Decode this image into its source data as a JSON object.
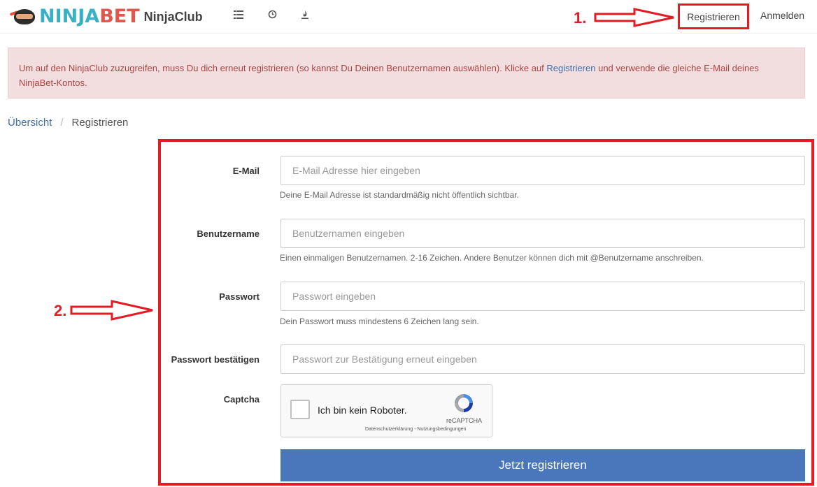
{
  "header": {
    "brand_ninja": "NINJA",
    "brand_bet": "BET",
    "club_label": "NinjaClub",
    "nav_icons": [
      "list-icon",
      "clock-icon",
      "flame-icon"
    ],
    "register_label": "Registrieren",
    "login_label": "Anmelden"
  },
  "annotations": {
    "step1": "1.",
    "step2": "2."
  },
  "alert": {
    "text_before": "Um auf den NinjaClub zuzugreifen, muss Du dich erneut registrieren (so kannst Du Deinen Benutzernamen auswählen). Klicke auf ",
    "link_text": "Registrieren",
    "text_after": " und verwende die gleiche E-Mail deines NinjaBet-Kontos."
  },
  "breadcrumb": {
    "home": "Übersicht",
    "separator": "/",
    "current": "Registrieren"
  },
  "form": {
    "email": {
      "label": "E-Mail",
      "placeholder": "E-Mail Adresse hier eingeben",
      "help": "Deine E-Mail Adresse ist standardmäßig nicht öffentlich sichtbar."
    },
    "username": {
      "label": "Benutzername",
      "placeholder": "Benutzernamen eingeben",
      "help": "Einen einmaligen Benutzernamen. 2-16 Zeichen. Andere Benutzer können dich mit @Benutzername anschreiben."
    },
    "password": {
      "label": "Passwort",
      "placeholder": "Passwort eingeben",
      "help": "Dein Passwort muss mindestens 6 Zeichen lang sein."
    },
    "password_confirm": {
      "label": "Passwort bestätigen",
      "placeholder": "Passwort zur Bestätigung erneut eingeben"
    },
    "captcha": {
      "label": "Captcha",
      "checkbox_text": "Ich bin kein Roboter.",
      "brand": "reCAPTCHA",
      "links": "Datenschutzerklärung - Nutzungsbedingungen"
    },
    "submit_label": "Jetzt registrieren"
  },
  "colors": {
    "annotation_red": "#e31b23",
    "primary_button": "#4a76bb",
    "alert_bg": "#f2dede",
    "alert_text": "#a94442",
    "link": "#3f6dad"
  }
}
